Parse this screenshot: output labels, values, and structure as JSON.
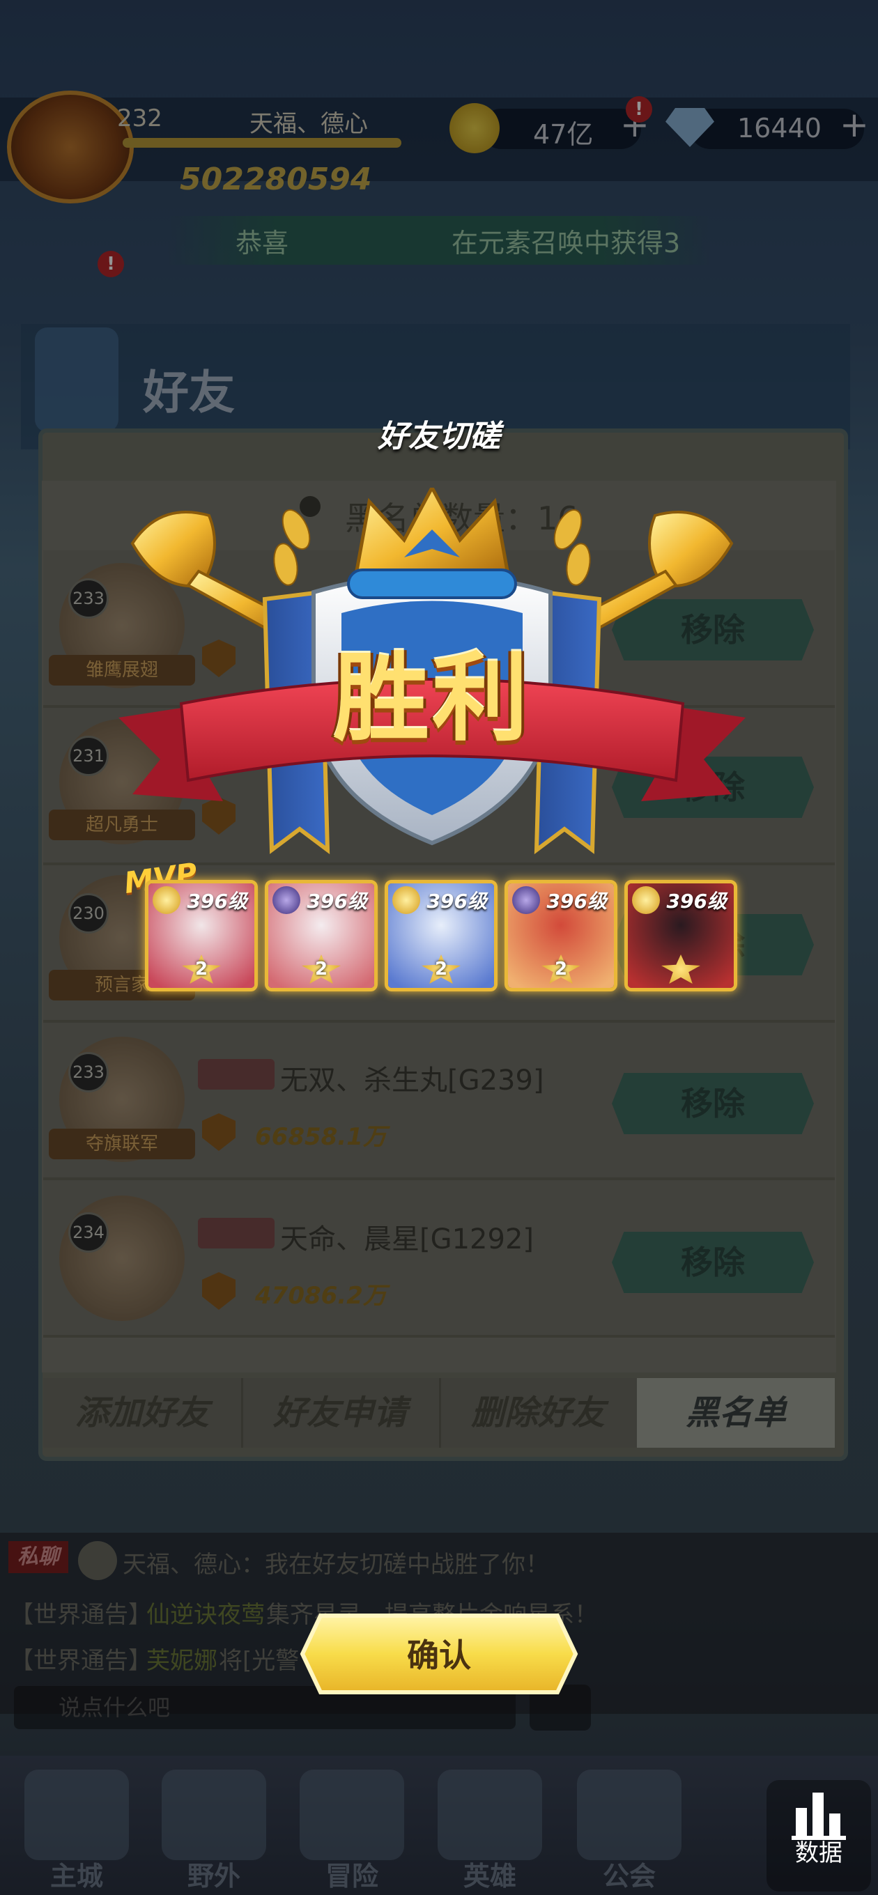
{
  "header": {
    "level": "232",
    "player_name": "天福、德心",
    "power": "502280594",
    "coins": "47亿",
    "gems": "16440",
    "badge_mark": "!"
  },
  "ticker": {
    "left": "恭喜",
    "right": "在元素召唤中获得3"
  },
  "friends_panel": {
    "title": "好友",
    "blacklist_count_label": "黑名单数量：16",
    "rows": [
      {
        "level": "233",
        "guild": "雏鹰展翅",
        "name": "",
        "power": "",
        "remove_label": "移除"
      },
      {
        "level": "231",
        "guild": "超凡勇士",
        "name": "",
        "power": "",
        "remove_label": "移除"
      },
      {
        "level": "230",
        "guild": "预言家",
        "name": "",
        "power": "",
        "remove_label": "移除"
      },
      {
        "level": "233",
        "guild": "夺旗联军",
        "name": "无双、杀生丸[G239]",
        "power": "66858.1万",
        "remove_label": "移除"
      },
      {
        "level": "234",
        "guild": "",
        "name": "天命、晨星[G1292]",
        "power": "47086.2万",
        "remove_label": "移除"
      }
    ],
    "tabs": [
      {
        "label": "添加好友",
        "active": false
      },
      {
        "label": "好友申请",
        "active": false
      },
      {
        "label": "删除好友",
        "active": false
      },
      {
        "label": "黑名单",
        "active": true
      }
    ]
  },
  "chat": {
    "tag": "私聊",
    "line1": "天福、德心：我在好友切磋中战胜了你！",
    "line2_prefix": "【世界通告】",
    "line2_name": "仙逆诀夜莺",
    "line2_rest": "集齐星灵，提高整片金响星系！",
    "line3_prefix": "【世界通告】",
    "line3_name": "芙妮娜",
    "line3_rest": "将[光警",
    "input_placeholder": "说点什么吧"
  },
  "nav": {
    "items": [
      "主城",
      "野外",
      "冒险",
      "英雄",
      "公会"
    ],
    "data_label": "数据"
  },
  "result_popup": {
    "title": "好友切磋",
    "result_text": "胜利",
    "mvp_label": "MVP",
    "heroes": [
      {
        "level": "396级",
        "stars": "2",
        "type": "gold",
        "palette": [
          "#f1e6e8",
          "#c9485a"
        ]
      },
      {
        "level": "396级",
        "stars": "2",
        "type": "purple",
        "palette": [
          "#f4ecef",
          "#d46a72"
        ]
      },
      {
        "level": "396级",
        "stars": "2",
        "type": "gold",
        "palette": [
          "#e7eefa",
          "#5a7ad0"
        ]
      },
      {
        "level": "396级",
        "stars": "2",
        "type": "purple",
        "palette": [
          "#d24a3a",
          "#f0b070"
        ]
      },
      {
        "level": "396级",
        "stars": "",
        "type": "gold",
        "palette": [
          "#2a1a20",
          "#b83030"
        ]
      }
    ],
    "confirm_label": "确认"
  },
  "colors": {
    "accent_gold": "#ffe070",
    "ribbon_red": "#d8283a",
    "shield_blue": "#2f6fc4",
    "confirm_yellow": "#f8dc4a"
  }
}
